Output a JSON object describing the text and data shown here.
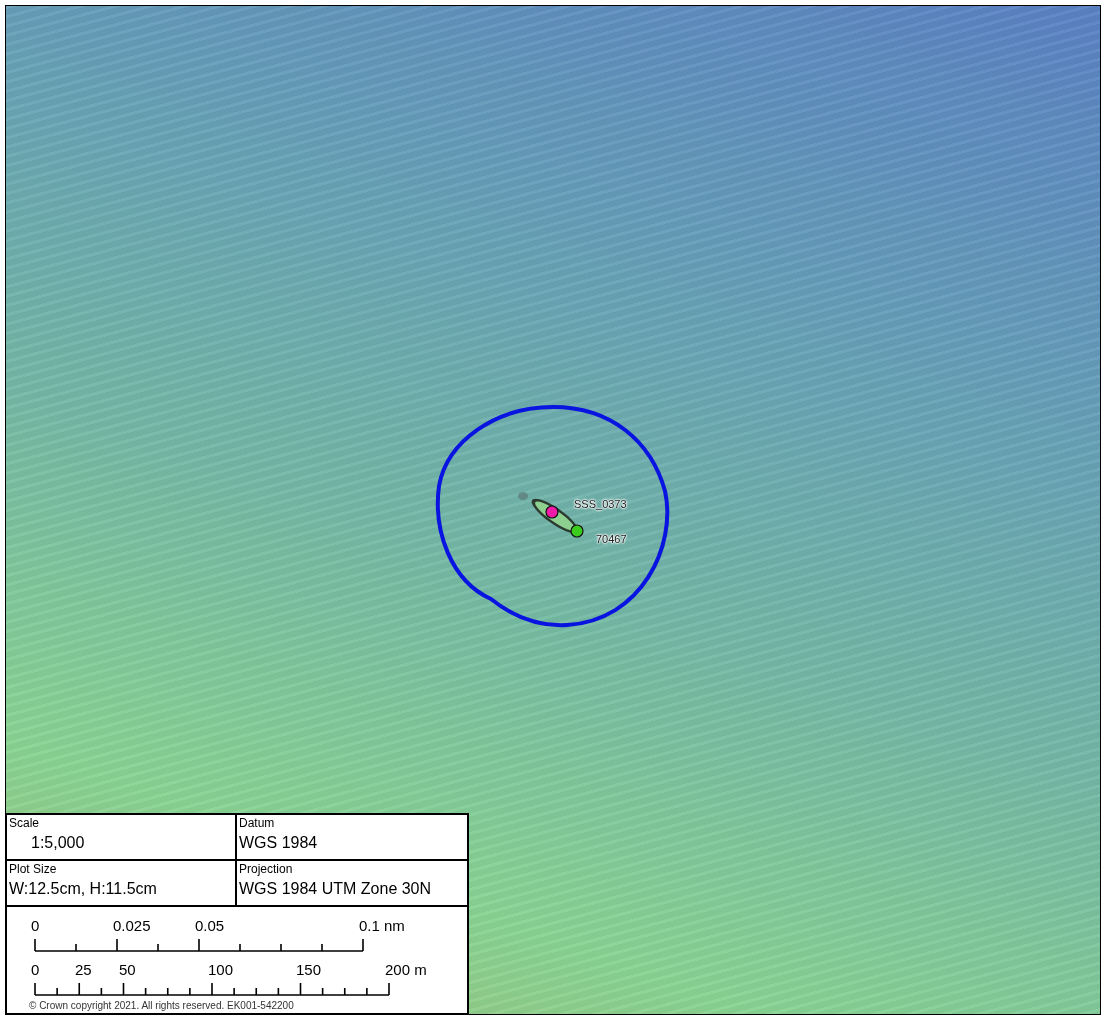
{
  "map": {
    "markers": [
      {
        "label": "SSS_0373",
        "color": "#f01aa8"
      },
      {
        "label": "70467",
        "color": "#3ccc1e"
      }
    ]
  },
  "legend": {
    "cells": [
      {
        "heading": "Scale",
        "value": "1:5,000"
      },
      {
        "heading": "Datum",
        "value": "WGS 1984"
      },
      {
        "heading": "Plot Size",
        "value": "W:12.5cm, H:11.5cm"
      },
      {
        "heading": "Projection",
        "value": "WGS 1984 UTM Zone 30N"
      }
    ],
    "scale_bars": [
      {
        "labels": [
          "0",
          "0.025",
          "0.05",
          "0.1 nm"
        ]
      },
      {
        "labels": [
          "0",
          "25",
          "50",
          "100",
          "150",
          "200 m"
        ]
      }
    ],
    "copyright": "© Crown copyright 2021. All rights reserved. EK001-542200"
  }
}
